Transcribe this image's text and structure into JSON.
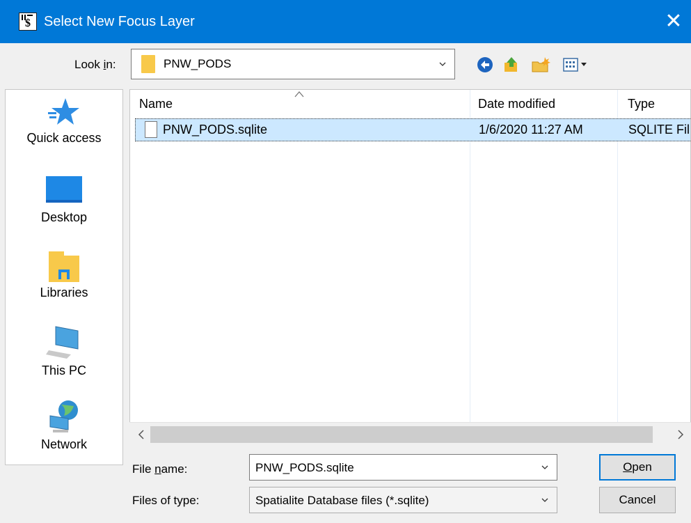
{
  "window": {
    "title": "Select New Focus Layer"
  },
  "lookin": {
    "label_pre": "Look ",
    "label_u": "i",
    "label_post": "n:",
    "value": "PNW_PODS"
  },
  "places": [
    {
      "label": "Quick access",
      "icon": "star-icon"
    },
    {
      "label": "Desktop",
      "icon": "desktop-icon"
    },
    {
      "label": "Libraries",
      "icon": "libraries-icon"
    },
    {
      "label": "This PC",
      "icon": "computer-icon"
    },
    {
      "label": "Network",
      "icon": "network-icon"
    }
  ],
  "columns": {
    "name": "Name",
    "date": "Date modified",
    "type": "Type"
  },
  "files": [
    {
      "name": "PNW_PODS.sqlite",
      "date": "1/6/2020 11:27 AM",
      "type": "SQLITE Fil"
    }
  ],
  "filename": {
    "label_pre": "File ",
    "label_u": "n",
    "label_post": "ame:",
    "value": "PNW_PODS.sqlite"
  },
  "filetype": {
    "label": "Files of type:",
    "value": "Spatialite Database files (*.sqlite)"
  },
  "buttons": {
    "open_u": "O",
    "open_rest": "pen",
    "cancel": "Cancel"
  },
  "colors": {
    "titlebar": "#0078d7",
    "selection": "#cce8ff",
    "folder": "#f8c94a"
  }
}
